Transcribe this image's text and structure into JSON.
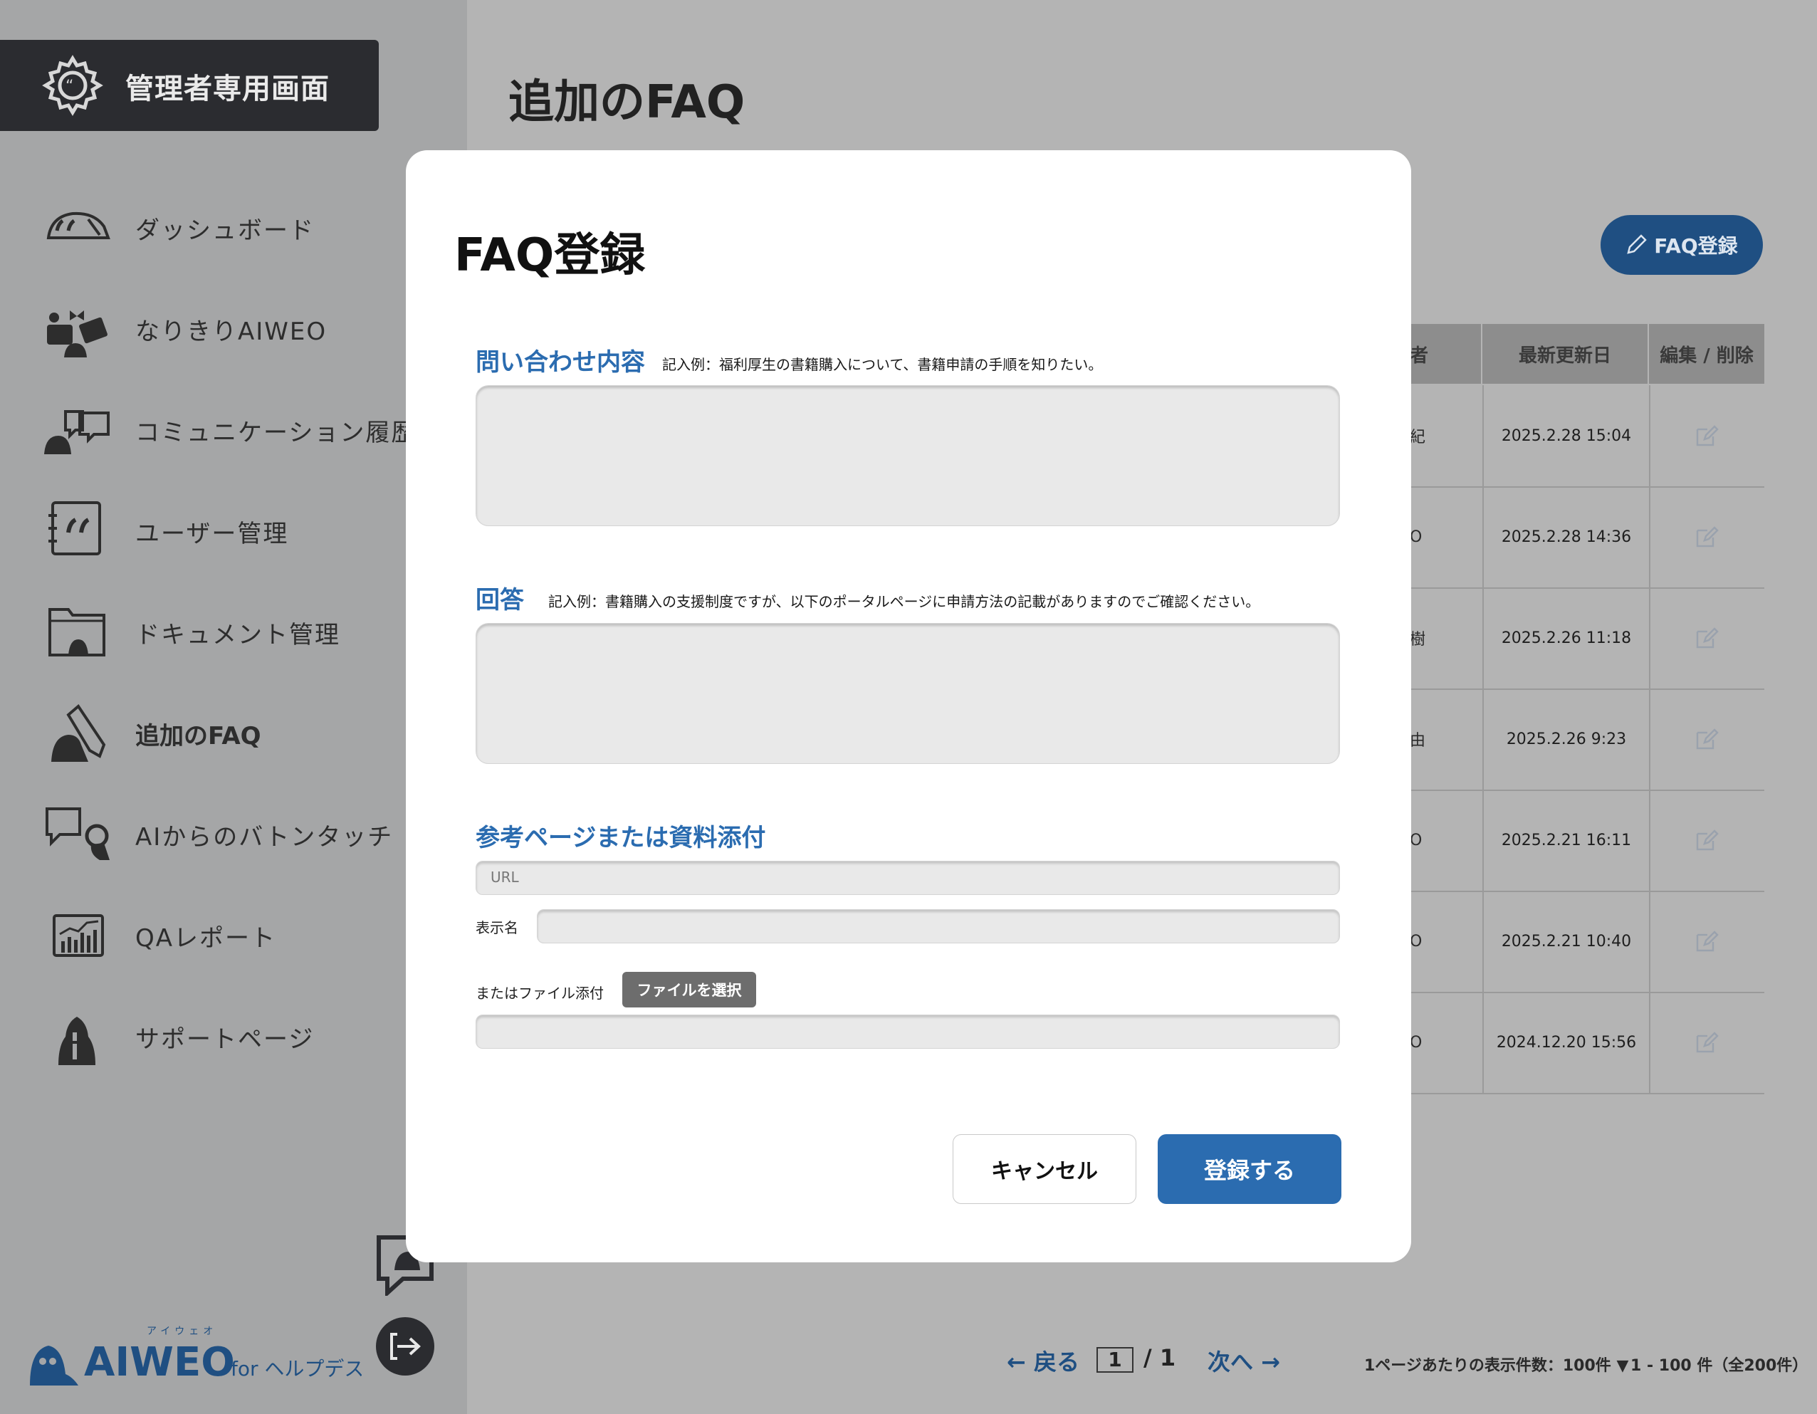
{
  "sidebar": {
    "header_title": "管理者専用画面",
    "items": [
      {
        "label": "ダッシュボード",
        "icon": "dashboard-icon"
      },
      {
        "label": "なりきりAIWEO",
        "icon": "persona-icon"
      },
      {
        "label": "コミュニケーション履歴",
        "icon": "chat-history-icon"
      },
      {
        "label": "ユーザー管理",
        "icon": "user-management-icon"
      },
      {
        "label": "ドキュメント管理",
        "icon": "folder-icon"
      },
      {
        "label": "追加のFAQ",
        "icon": "pencil-faq-icon",
        "active": true
      },
      {
        "label": "AIからのバトンタッチ",
        "icon": "baton-touch-icon"
      },
      {
        "label": "QAレポート",
        "icon": "report-icon"
      },
      {
        "label": "サポートページ",
        "icon": "support-icon"
      }
    ],
    "logo": {
      "brand": "AIWEO",
      "ruby": "アイウェオ",
      "suffix": "for ヘルプデスク"
    }
  },
  "main": {
    "title": "追加のFAQ",
    "register_button": "FAQ登録",
    "table": {
      "headers": [
        "者",
        "最新更新日",
        "編集 / 削除"
      ],
      "rows": [
        {
          "author": "紀",
          "date": "2025.2.28 15:04"
        },
        {
          "author": "O",
          "date": "2025.2.28 14:36"
        },
        {
          "author": "樹",
          "date": "2025.2.26 11:18"
        },
        {
          "author": "由",
          "date": "2025.2.26 9:23"
        },
        {
          "author": "O",
          "date": "2025.2.21 16:11"
        },
        {
          "author": "O",
          "date": "2025.2.21 10:40"
        },
        {
          "author": "O",
          "date": "2024.12.20 15:56"
        }
      ]
    },
    "pagination": {
      "back": "戻る",
      "page": "1",
      "total": "/ 1",
      "next": "次へ",
      "per_page": "1ページあたりの表示件数：100件 ▼",
      "range": "1 - 100 件（全200件）"
    }
  },
  "modal": {
    "title": "FAQ登録",
    "question_label": "問い合わせ内容",
    "question_hint": "記入例：福利厚生の書籍購入について、書籍申請の手順を知りたい。",
    "question_value": "",
    "answer_label": "回答",
    "answer_hint": "記入例：書籍購入の支援制度ですが、以下のポータルページに申請方法の記載がありますのでご確認ください。",
    "answer_value": "",
    "reference_label": "参考ページまたは資料添付",
    "url_placeholder": "URL",
    "display_name_label": "表示名",
    "file_label": "またはファイル添付",
    "file_button": "ファイルを選択",
    "cancel": "キャンセル",
    "submit": "登録する"
  },
  "colors": {
    "accent": "#2b6cb0",
    "sidebar_header": "#2b2c30",
    "overlay": "#b4b4b4"
  }
}
